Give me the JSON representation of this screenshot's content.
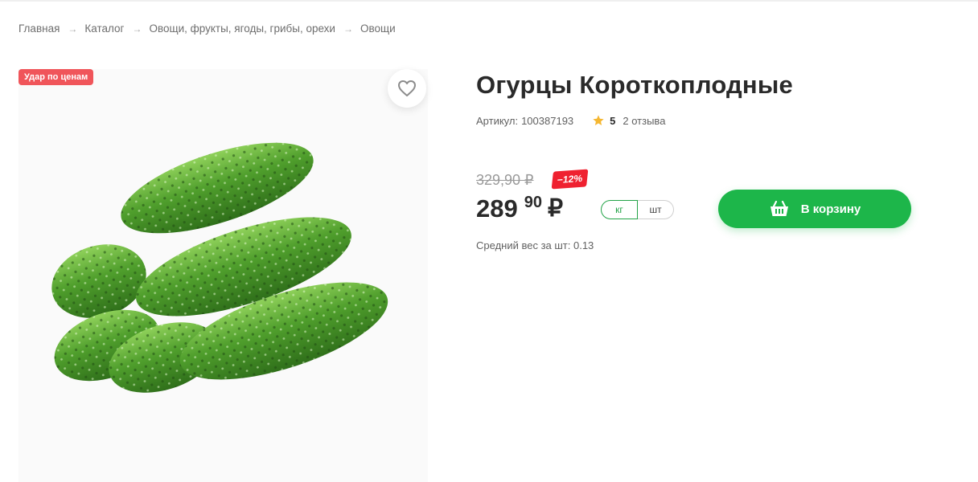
{
  "breadcrumb": [
    {
      "label": "Главная"
    },
    {
      "label": "Каталог"
    },
    {
      "label": "Овощи, фрукты, ягоды, грибы, орехи"
    },
    {
      "label": "Овощи"
    }
  ],
  "breadcrumb_separator": "→",
  "promo_badge": "Удар по ценам",
  "favorite_icon": "heart-icon",
  "product": {
    "title": "Огурцы Короткоплодные",
    "sku_label": "Артикул:",
    "sku": "100387193",
    "rating": "5",
    "reviews": "2 отзыва",
    "old_price": "329,90 ₽",
    "discount": "−12%",
    "price_int": "289",
    "price_frac": "90",
    "currency": "₽",
    "units": [
      "кг",
      "шт"
    ],
    "selected_unit": "кг",
    "cart_button": "В корзину",
    "avg_weight": "Средний вес за шт: 0.13"
  },
  "colors": {
    "accent_green": "#1db64a",
    "promo_red": "#f0555a",
    "discount_red": "#ef2130",
    "star": "#f5b731"
  }
}
